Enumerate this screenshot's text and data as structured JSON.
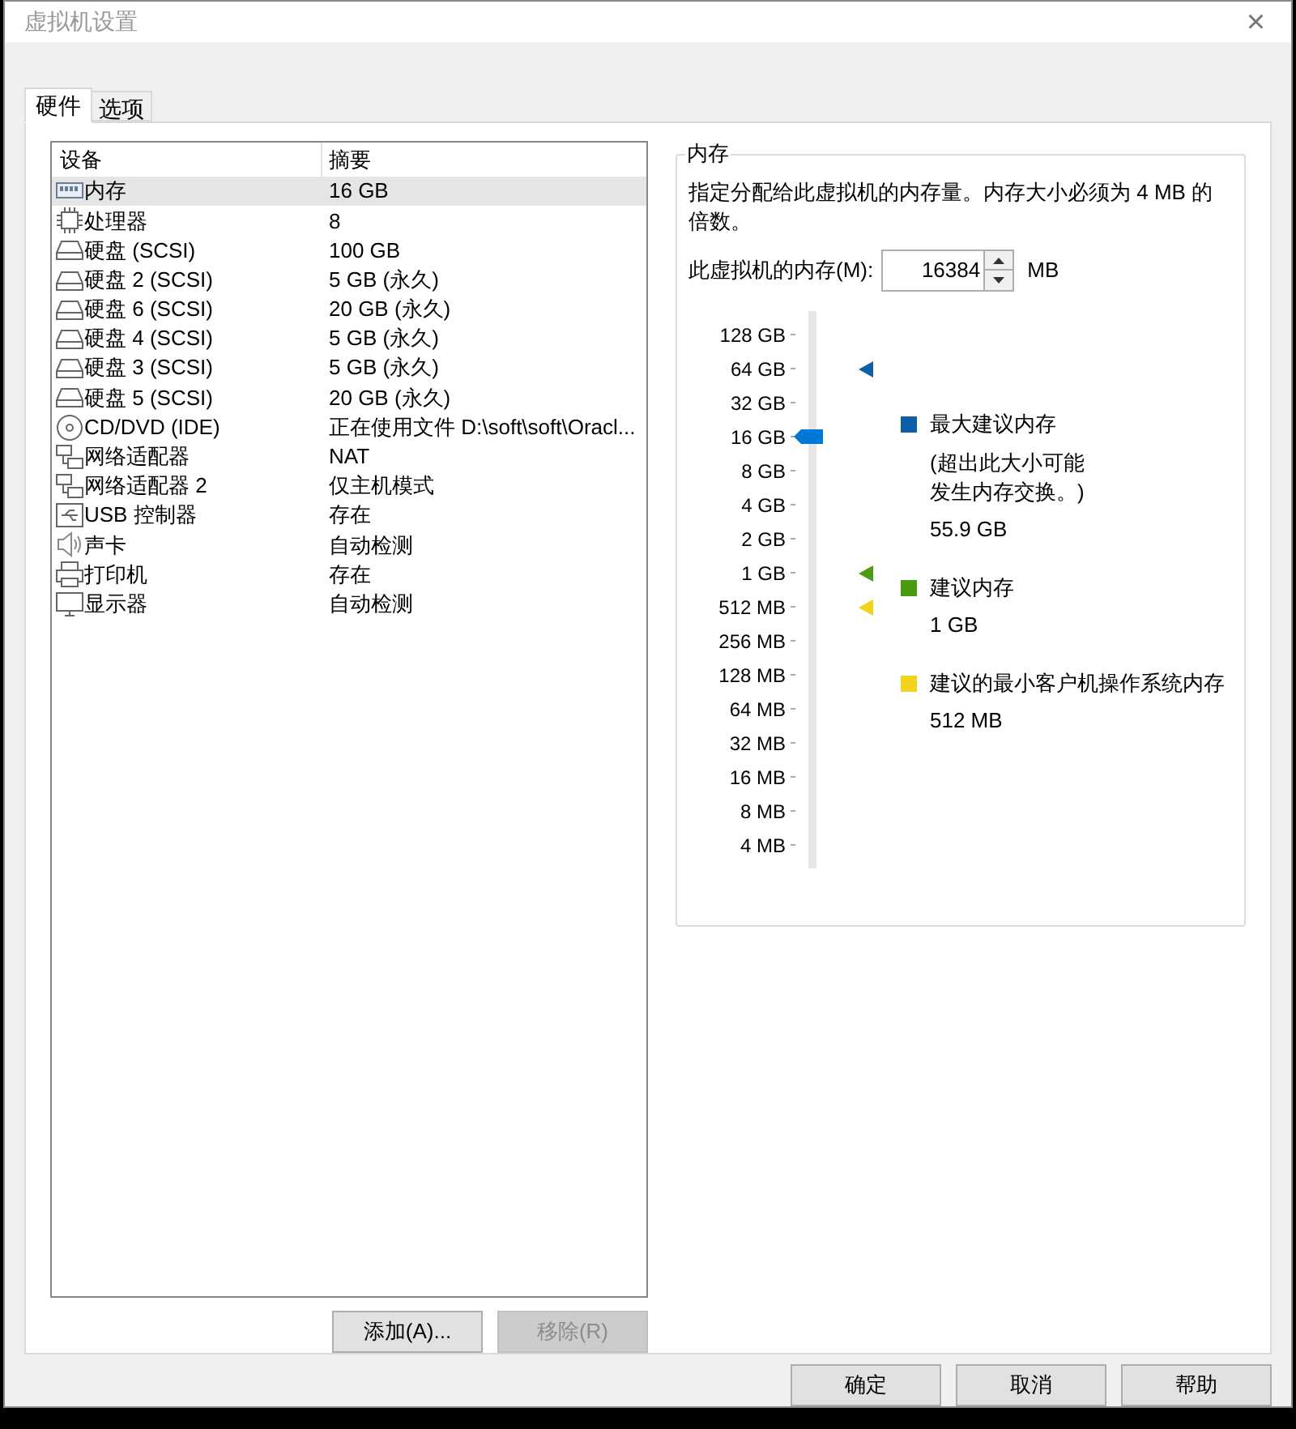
{
  "window": {
    "title": "虚拟机设置",
    "close": "×"
  },
  "tabs": [
    {
      "label": "硬件",
      "selected": true
    },
    {
      "label": "选项",
      "selected": false
    }
  ],
  "device_table": {
    "columns": [
      "设备",
      "摘要"
    ],
    "rows": [
      {
        "kind": "memory",
        "device": "内存",
        "summary": "16 GB",
        "selected": true
      },
      {
        "kind": "cpu",
        "device": "处理器",
        "summary": "8",
        "selected": false
      },
      {
        "kind": "disk",
        "device": "硬盘 (SCSI)",
        "summary": "100 GB",
        "selected": false
      },
      {
        "kind": "disk",
        "device": "硬盘 2 (SCSI)",
        "summary": "5 GB (永久)",
        "selected": false
      },
      {
        "kind": "disk",
        "device": "硬盘 6 (SCSI)",
        "summary": "20 GB (永久)",
        "selected": false
      },
      {
        "kind": "disk",
        "device": "硬盘 4 (SCSI)",
        "summary": "5 GB (永久)",
        "selected": false
      },
      {
        "kind": "disk",
        "device": "硬盘 3 (SCSI)",
        "summary": "5 GB (永久)",
        "selected": false
      },
      {
        "kind": "disk",
        "device": "硬盘 5 (SCSI)",
        "summary": "20 GB (永久)",
        "selected": false
      },
      {
        "kind": "cdrom",
        "device": "CD/DVD (IDE)",
        "summary": "正在使用文件 D:\\soft\\soft\\Oracl...",
        "selected": false
      },
      {
        "kind": "network",
        "device": "网络适配器",
        "summary": "NAT",
        "selected": false
      },
      {
        "kind": "network",
        "device": "网络适配器 2",
        "summary": "仅主机模式",
        "selected": false
      },
      {
        "kind": "usb",
        "device": "USB 控制器",
        "summary": "存在",
        "selected": false
      },
      {
        "kind": "sound",
        "device": "声卡",
        "summary": "自动检测",
        "selected": false
      },
      {
        "kind": "printer",
        "device": "打印机",
        "summary": "存在",
        "selected": false
      },
      {
        "kind": "display",
        "device": "显示器",
        "summary": "自动检测",
        "selected": false
      }
    ]
  },
  "list_buttons": [
    {
      "label": "添加(A)...",
      "disabled": false
    },
    {
      "label": "移除(R)",
      "disabled": true
    }
  ],
  "memory": {
    "title": "内存",
    "description": "指定分配给此虚拟机的内存量。内存大小必须为 4 MB 的倍数。",
    "field_label": "此虚拟机的内存(M):",
    "value": "16384",
    "unit": "MB",
    "slider": {
      "level": 0.8,
      "ticks": [
        {
          "label": "128 GB"
        },
        {
          "label": "64 GB",
          "color": "#0c5fa8"
        },
        {
          "label": "32 GB"
        },
        {
          "label": "16 GB"
        },
        {
          "label": "8 GB"
        },
        {
          "label": "4 GB"
        },
        {
          "label": "2 GB"
        },
        {
          "label": "1 GB",
          "color": "#4a9a14"
        },
        {
          "label": "512 MB",
          "color": "#f2d21c"
        },
        {
          "label": "256 MB"
        },
        {
          "label": "128 MB"
        },
        {
          "label": "64 MB"
        },
        {
          "label": "32 MB"
        },
        {
          "label": "16 MB"
        },
        {
          "label": "8 MB"
        },
        {
          "label": "4 MB"
        }
      ]
    },
    "legend": [
      {
        "color": "#0c5fa8",
        "title": "最大建议内存",
        "note": "(超出此大小可能发生内存交换。)",
        "value": "55.9 GB"
      },
      {
        "color": "#4a9a14",
        "title": "建议内存",
        "value": "1 GB"
      },
      {
        "color": "#f2d21c",
        "title": "建议的最小客户机操作系统内存",
        "value": "512 MB"
      }
    ]
  },
  "footer_buttons": [
    "确定",
    "取消",
    "帮助"
  ]
}
